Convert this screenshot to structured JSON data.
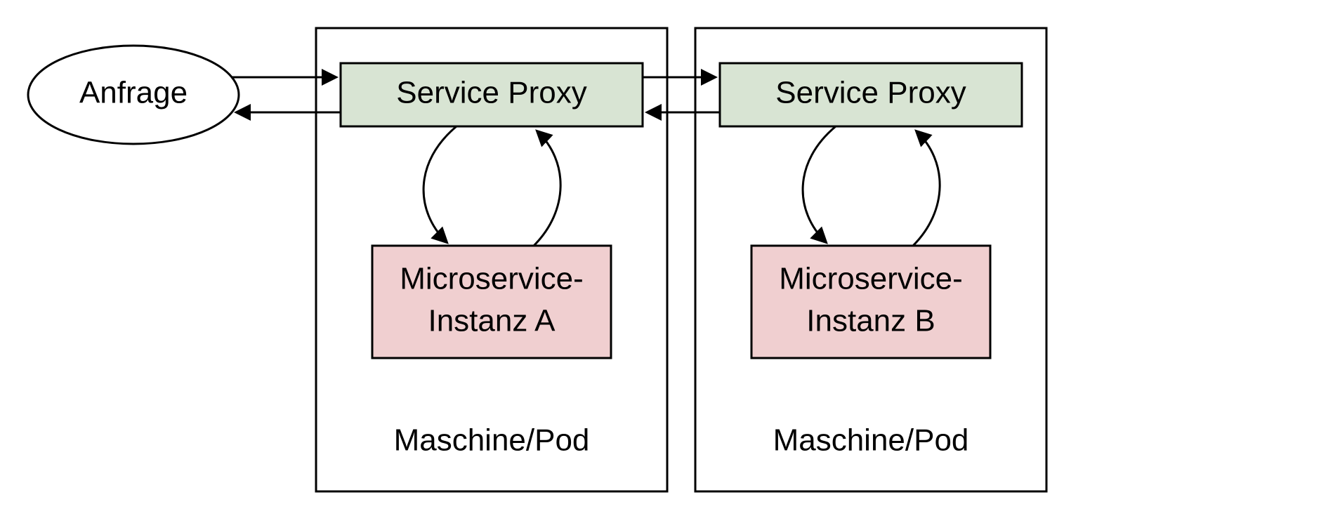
{
  "diagram": {
    "request_label": "Anfrage",
    "pod_a": {
      "title": "Maschine/Pod",
      "proxy_label": "Service Proxy",
      "service_line1": "Microservice-",
      "service_line2": "Instanz A"
    },
    "pod_b": {
      "title": "Maschine/Pod",
      "proxy_label": "Service Proxy",
      "service_line1": "Microservice-",
      "service_line2": "Instanz B"
    },
    "colors": {
      "proxy_fill": "#d8e4d3",
      "service_fill": "#f0cfd0",
      "stroke": "#000000"
    }
  }
}
